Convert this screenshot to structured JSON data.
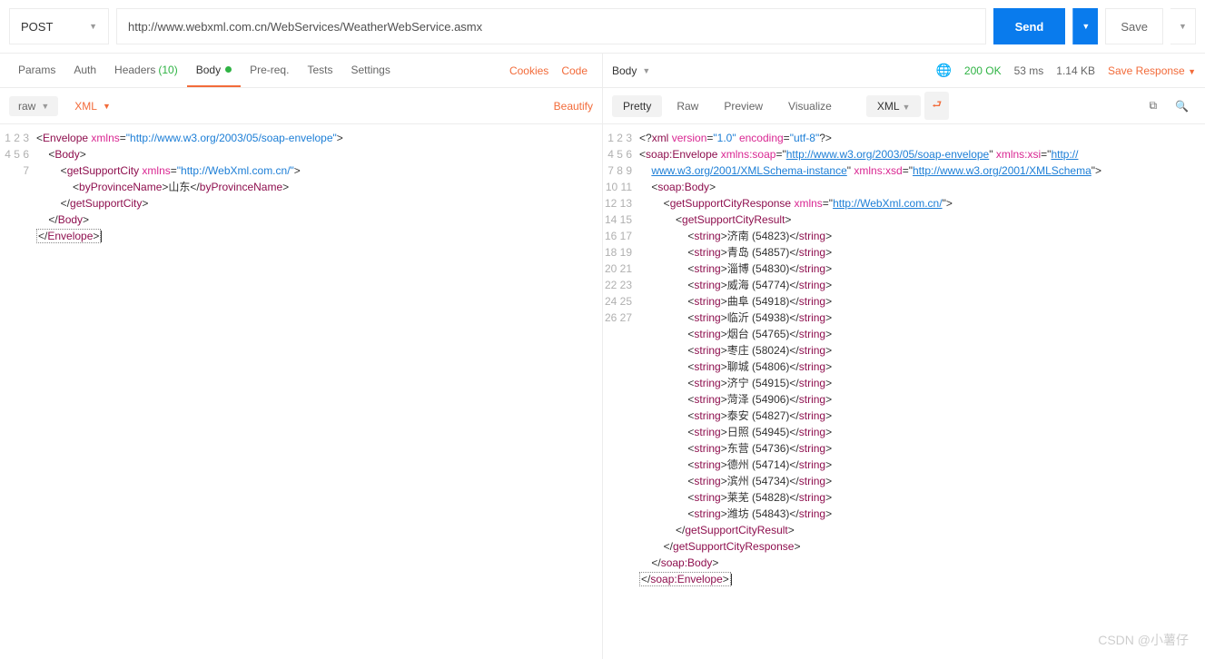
{
  "topbar": {
    "method": "POST",
    "url": "http://www.webxml.com.cn/WebServices/WeatherWebService.asmx",
    "send": "Send",
    "save": "Save"
  },
  "req_tabs": {
    "params": "Params",
    "auth": "Auth",
    "headers": "Headers",
    "headers_count": "(10)",
    "body": "Body",
    "prereq": "Pre-req.",
    "tests": "Tests",
    "settings": "Settings",
    "cookies": "Cookies",
    "code": "Code"
  },
  "req_sub": {
    "raw": "raw",
    "xml": "XML",
    "beautify": "Beautify"
  },
  "req_lines": [
    "1",
    "2",
    "3",
    "4",
    "5",
    "6",
    "7"
  ],
  "req": {
    "env_url": "http://www.w3.org/2003/05/soap-envelope",
    "svc_url": "http://WebXml.com.cn/",
    "province": "山东"
  },
  "resp_head": {
    "body": "Body",
    "status": "200 OK",
    "time": "53 ms",
    "size": "1.14 KB",
    "save": "Save Response"
  },
  "resp_tabs": {
    "pretty": "Pretty",
    "raw": "Raw",
    "preview": "Preview",
    "visualize": "Visualize",
    "xml": "XML"
  },
  "resp_lines": [
    "1",
    "2",
    "3",
    "4",
    "5",
    "6",
    "7",
    "8",
    "9",
    "10",
    "11",
    "12",
    "13",
    "14",
    "15",
    "16",
    "17",
    "18",
    "19",
    "20",
    "21",
    "22",
    "23",
    "24",
    "25",
    "26",
    "27"
  ],
  "resp": {
    "soap_ns": "http://www.w3.org/2003/05/soap-envelope",
    "xsi_ns": "http://www.w3.org/2001/XMLSchema-instance",
    "xsd_ns": "http://www.w3.org/2001/XMLSchema",
    "svc_ns": "http://WebXml.com.cn/",
    "cities": [
      "济南 (54823)",
      "青岛 (54857)",
      "淄博 (54830)",
      "威海 (54774)",
      "曲阜 (54918)",
      "临沂 (54938)",
      "烟台 (54765)",
      "枣庄 (58024)",
      "聊城 (54806)",
      "济宁 (54915)",
      "菏泽 (54906)",
      "泰安 (54827)",
      "日照 (54945)",
      "东营 (54736)",
      "德州 (54714)",
      "滨州 (54734)",
      "莱芜 (54828)",
      "潍坊 (54843)"
    ]
  },
  "watermark": "CSDN @小薯仔"
}
